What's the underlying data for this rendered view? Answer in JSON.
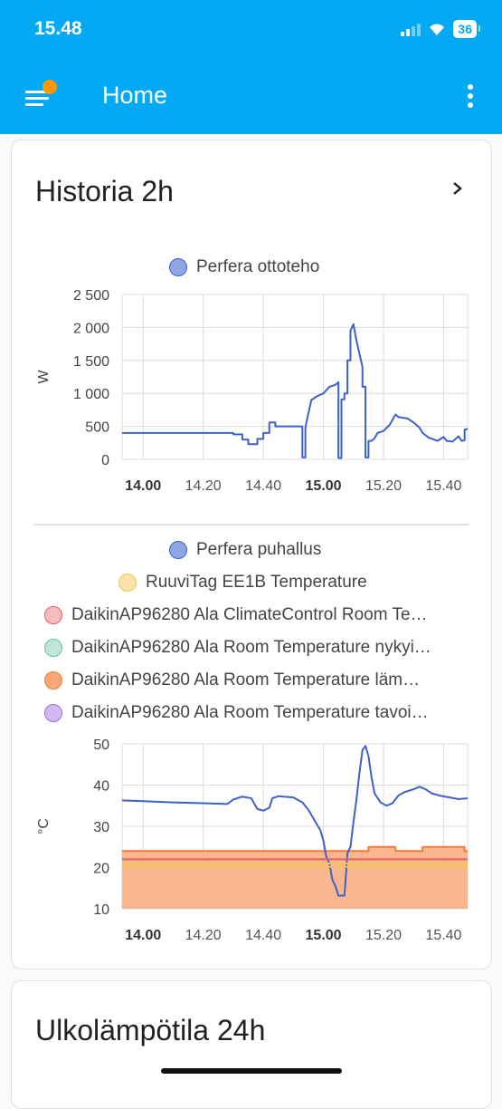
{
  "status_bar": {
    "time": "15.48",
    "battery": "36"
  },
  "app_bar": {
    "title": "Home"
  },
  "history_card": {
    "title": "Historia 2h"
  },
  "power_chart": {
    "legend": [
      {
        "label": "Perfera ottoteho",
        "color": "#4466cc"
      }
    ],
    "chart_data": {
      "type": "line",
      "ylabel": "W",
      "ylim": [
        0,
        2500
      ],
      "yticks": [
        "2 500",
        "2 000",
        "1 500",
        "1 000",
        "500",
        "0"
      ],
      "xticks": [
        "14.00",
        "14.20",
        "14.40",
        "15.00",
        "15.20",
        "15.40"
      ],
      "bold_xticks": [
        "14.00",
        "15.00"
      ],
      "series": [
        {
          "name": "Perfera ottoteho",
          "color": "#3d62c9",
          "points": [
            [
              "13.53",
              400
            ],
            [
              "14.30",
              400
            ],
            [
              "14.30",
              380
            ],
            [
              "14.33",
              380
            ],
            [
              "14.33",
              300
            ],
            [
              "14.35",
              300
            ],
            [
              "14.35",
              230
            ],
            [
              "14.38",
              230
            ],
            [
              "14.38",
              310
            ],
            [
              "14.40",
              310
            ],
            [
              "14.40",
              400
            ],
            [
              "14.42",
              400
            ],
            [
              "14.42",
              560
            ],
            [
              "14.44",
              560
            ],
            [
              "14.44",
              500
            ],
            [
              "14.53",
              500
            ],
            [
              "14.53",
              30
            ],
            [
              "14.54",
              30
            ],
            [
              "14.54",
              480
            ],
            [
              "14.55",
              700
            ],
            [
              "14.56",
              900
            ],
            [
              "14.58",
              960
            ],
            [
              "15.00",
              1000
            ],
            [
              "15.02",
              1100
            ],
            [
              "15.04",
              1130
            ],
            [
              "15.05",
              1170
            ],
            [
              "15.05",
              20
            ],
            [
              "15.06",
              20
            ],
            [
              "15.06",
              910
            ],
            [
              "15.07",
              910
            ],
            [
              "15.07",
              1000
            ],
            [
              "15.08",
              1000
            ],
            [
              "15.08",
              1500
            ],
            [
              "15.09",
              1500
            ],
            [
              "15.09",
              1950
            ],
            [
              "15.10",
              2050
            ],
            [
              "15.11",
              1800
            ],
            [
              "15.12",
              1600
            ],
            [
              "15.13",
              1400
            ],
            [
              "15.13",
              1100
            ],
            [
              "15.14",
              1100
            ],
            [
              "15.14",
              30
            ],
            [
              "15.15",
              30
            ],
            [
              "15.15",
              280
            ],
            [
              "15.16",
              280
            ],
            [
              "15.17",
              320
            ],
            [
              "15.18",
              400
            ],
            [
              "15.20",
              430
            ],
            [
              "15.22",
              520
            ],
            [
              "15.23",
              600
            ],
            [
              "15.24",
              680
            ],
            [
              "15.25",
              640
            ],
            [
              "15.28",
              620
            ],
            [
              "15.30",
              560
            ],
            [
              "15.32",
              480
            ],
            [
              "15.33",
              400
            ],
            [
              "15.35",
              330
            ],
            [
              "15.38",
              280
            ],
            [
              "15.40",
              340
            ],
            [
              "15.41",
              280
            ],
            [
              "15.43",
              270
            ],
            [
              "15.45",
              350
            ],
            [
              "15.46",
              280
            ],
            [
              "15.47",
              290
            ],
            [
              "15.47",
              450
            ],
            [
              "15.48",
              460
            ]
          ]
        }
      ]
    }
  },
  "temp_chart": {
    "legend": [
      {
        "label": "Perfera puhallus",
        "color": "#4466cc"
      },
      {
        "label": "RuuviTag EE1B Temperature",
        "color": "#f3c25a"
      },
      {
        "label": "DaikinAP96280 Ala ClimateControl Room Te…",
        "color": "#f08080"
      },
      {
        "label": "DaikinAP96280 Ala Room Temperature nykyi…",
        "color": "#66c2a5"
      },
      {
        "label": "DaikinAP96280 Ala Room Temperature läm…",
        "color": "#f07b3a"
      },
      {
        "label": "DaikinAP96280 Ala Room Temperature tavoi…",
        "color": "#a06ee0"
      }
    ],
    "chart_data": {
      "type": "line",
      "ylabel": "°C",
      "ylim": [
        10,
        50
      ],
      "yticks": [
        "50",
        "40",
        "30",
        "20",
        "10"
      ],
      "xticks": [
        "14.00",
        "14.20",
        "14.40",
        "15.00",
        "15.20",
        "15.40"
      ],
      "bold_xticks": [
        "14.00",
        "15.00"
      ],
      "series": [
        {
          "name": "Perfera puhallus",
          "color": "#3d62c9",
          "points": [
            [
              "13.53",
              36.3
            ],
            [
              "14.00",
              36.1
            ],
            [
              "14.10",
              35.8
            ],
            [
              "14.20",
              35.6
            ],
            [
              "14.28",
              35.4
            ],
            [
              "14.30",
              36.5
            ],
            [
              "14.33",
              37.2
            ],
            [
              "14.36",
              36.8
            ],
            [
              "14.38",
              34.2
            ],
            [
              "14.40",
              33.8
            ],
            [
              "14.42",
              34.5
            ],
            [
              "14.43",
              36.8
            ],
            [
              "14.45",
              37.3
            ],
            [
              "14.50",
              37.0
            ],
            [
              "14.53",
              35.8
            ],
            [
              "14.55",
              34.0
            ],
            [
              "14.57",
              31.5
            ],
            [
              "14.59",
              29.0
            ],
            [
              "15.00",
              26.5
            ],
            [
              "15.01",
              22.5
            ],
            [
              "15.02",
              21.0
            ],
            [
              "15.03",
              17.0
            ],
            [
              "15.04",
              15.5
            ],
            [
              "15.05",
              13.2
            ],
            [
              "15.07",
              13.2
            ],
            [
              "15.08",
              23.5
            ],
            [
              "15.09",
              25.0
            ],
            [
              "15.10",
              31.0
            ],
            [
              "15.11",
              36.5
            ],
            [
              "15.12",
              43.0
            ],
            [
              "15.13",
              48.5
            ],
            [
              "15.14",
              49.5
            ],
            [
              "15.15",
              47.0
            ],
            [
              "15.16",
              42.0
            ],
            [
              "15.17",
              38.0
            ],
            [
              "15.19",
              35.8
            ],
            [
              "15.21",
              35.0
            ],
            [
              "15.23",
              35.6
            ],
            [
              "15.25",
              37.5
            ],
            [
              "15.27",
              38.3
            ],
            [
              "15.30",
              39.0
            ],
            [
              "15.32",
              39.6
            ],
            [
              "15.34",
              39.0
            ],
            [
              "15.36",
              38.0
            ],
            [
              "15.39",
              37.4
            ],
            [
              "15.42",
              37.0
            ],
            [
              "15.45",
              36.6
            ],
            [
              "15.48",
              36.8
            ]
          ]
        },
        {
          "name": "DaikinAP96280 Ala Room Temperature läm",
          "color": "#f07b3a",
          "fill": true,
          "points": [
            [
              "13.53",
              24
            ],
            [
              "15.15",
              24
            ],
            [
              "15.15",
              25
            ],
            [
              "15.24",
              25
            ],
            [
              "15.24",
              24
            ],
            [
              "15.33",
              24
            ],
            [
              "15.33",
              25
            ],
            [
              "15.47",
              25
            ],
            [
              "15.47",
              24
            ],
            [
              "15.48",
              24
            ]
          ]
        },
        {
          "name": "DaikinAP96280 Ala ClimateControl Room Te",
          "color": "#e06060",
          "points": [
            [
              "13.53",
              22
            ],
            [
              "15.48",
              22
            ]
          ]
        },
        {
          "name": "RuuviTag EE1B Temperature",
          "color": "#f3c25a",
          "points": [
            [
              "13.53",
              21
            ],
            [
              "15.48",
              21
            ]
          ]
        },
        {
          "name": "DaikinAP96280 Ala Room Temperature nykyi",
          "color": "#f3c25a",
          "points": [
            [
              "13.53",
              20.2
            ],
            [
              "15.48",
              20.2
            ]
          ]
        }
      ]
    }
  },
  "outdoor_card": {
    "title": "Ulkolämpötila 24h"
  }
}
